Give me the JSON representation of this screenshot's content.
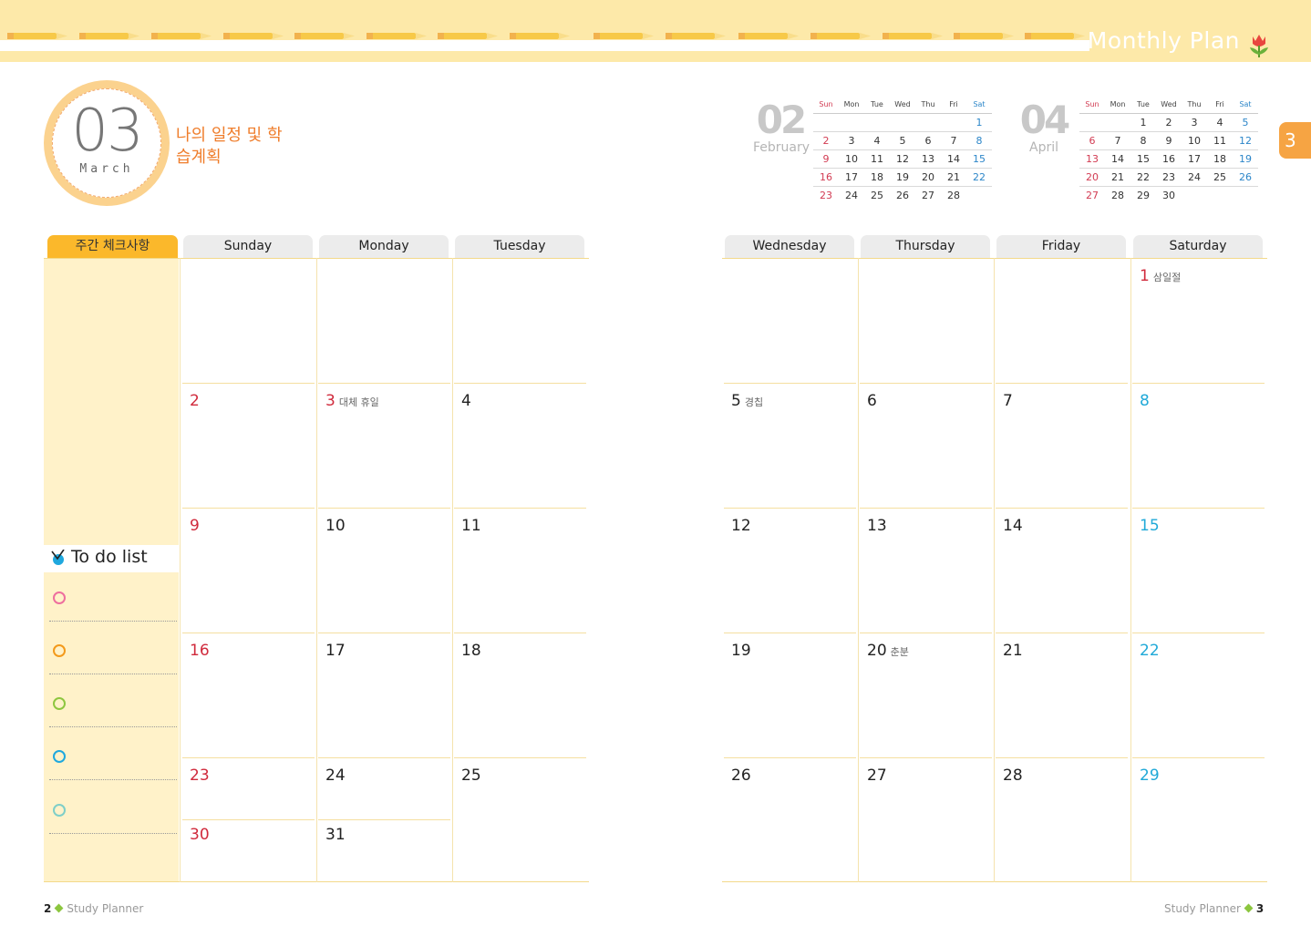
{
  "header": {
    "title": "Monthly Plan",
    "tulip_icon": "tulip-icon",
    "band_color": "#fde9a9"
  },
  "month_badge": {
    "number": "03",
    "name": "March",
    "color": "#fbd28e"
  },
  "plan_title": "나의 일정 및 학습계획",
  "page_tab": "3",
  "mini_calendars": {
    "weekday_labels": [
      "Sun",
      "Mon",
      "Tue",
      "Wed",
      "Thu",
      "Fri",
      "Sat"
    ],
    "prev": {
      "number": "02",
      "name": "February",
      "rows": [
        [
          "",
          "",
          "",
          "",
          "",
          "",
          "1"
        ],
        [
          "2",
          "3",
          "4",
          "5",
          "6",
          "7",
          "8"
        ],
        [
          "9",
          "10",
          "11",
          "12",
          "13",
          "14",
          "15"
        ],
        [
          "16",
          "17",
          "18",
          "19",
          "20",
          "21",
          "22"
        ],
        [
          "23",
          "24",
          "25",
          "26",
          "27",
          "28",
          ""
        ]
      ]
    },
    "next": {
      "number": "04",
      "name": "April",
      "rows": [
        [
          "",
          "",
          "1",
          "2",
          "3",
          "4",
          "5"
        ],
        [
          "6",
          "7",
          "8",
          "9",
          "10",
          "11",
          "12"
        ],
        [
          "13",
          "14",
          "15",
          "16",
          "17",
          "18",
          "19"
        ],
        [
          "20",
          "21",
          "22",
          "23",
          "24",
          "25",
          "26"
        ],
        [
          "27",
          "28",
          "29",
          "30",
          "",
          "",
          ""
        ]
      ]
    }
  },
  "calendar": {
    "weekly_header": "주간 체크사항",
    "days": [
      "Sunday",
      "Monday",
      "Tuesday",
      "Wednesday",
      "Thursday",
      "Friday",
      "Saturday"
    ],
    "weeks": [
      [
        "",
        "",
        "",
        "",
        "",
        "",
        "1"
      ],
      [
        "2",
        "3",
        "4",
        "5",
        "6",
        "7",
        "8"
      ],
      [
        "9",
        "10",
        "11",
        "12",
        "13",
        "14",
        "15"
      ],
      [
        "16",
        "17",
        "18",
        "19",
        "20",
        "21",
        "22"
      ],
      [
        "23",
        "24",
        "25",
        "26",
        "27",
        "28",
        "29"
      ],
      [
        "30",
        "31",
        "",
        "",
        "",
        "",
        ""
      ]
    ],
    "notes": {
      "1": "삼일절",
      "3": "대체 휴일",
      "5": "경칩",
      "20": "춘분"
    },
    "red_days": [
      "1",
      "2",
      "3",
      "9",
      "16",
      "23",
      "30"
    ],
    "blue_days": [
      "8",
      "15",
      "22",
      "29"
    ]
  },
  "todo": {
    "title": "To do list",
    "check_icon": "check-icon",
    "circle_colors": [
      "#ee6f9e",
      "#f39a1b",
      "#8ec63f",
      "#1fa8de",
      "#7fcfc8"
    ]
  },
  "footer": {
    "left_page": "2",
    "right_page": "3",
    "label": "Study Planner"
  }
}
